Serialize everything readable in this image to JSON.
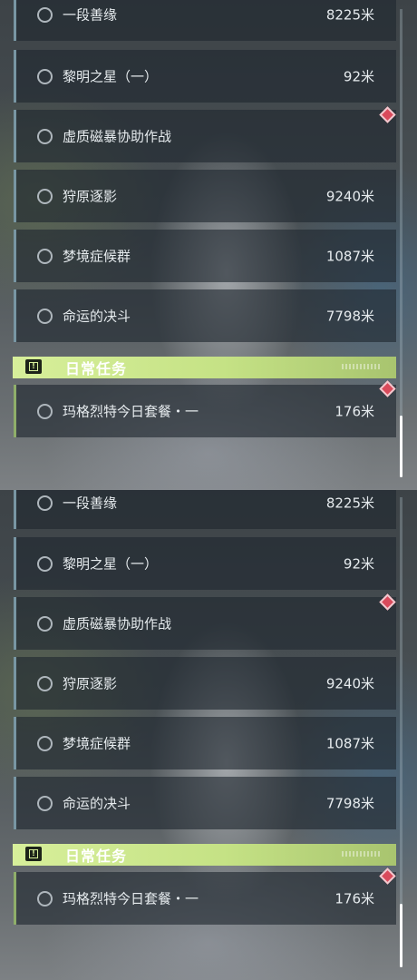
{
  "panels": [
    {
      "quests": [
        {
          "name": "一段善缘",
          "distance": "8225米"
        },
        {
          "name": "黎明之星（一）",
          "distance": "92米"
        },
        {
          "name": "虚质磁暴协助作战",
          "distance": ""
        },
        {
          "name": "狩原逐影",
          "distance": "9240米"
        },
        {
          "name": "梦境症候群",
          "distance": "1087米"
        },
        {
          "name": "命运的决斗",
          "distance": "7798米"
        }
      ],
      "daily_header": {
        "title": "日常任务",
        "icon": "alert-box-icon"
      },
      "daily_quests": [
        {
          "name": "玛格烈特今日套餐・一",
          "distance": "176米"
        }
      ]
    },
    {
      "quests": [
        {
          "name": "一段善缘",
          "distance": "8225米"
        },
        {
          "name": "黎明之星（一）",
          "distance": "92米"
        },
        {
          "name": "虚质磁暴协助作战",
          "distance": ""
        },
        {
          "name": "狩原逐影",
          "distance": "9240米"
        },
        {
          "name": "梦境症候群",
          "distance": "1087米"
        },
        {
          "name": "命运的决斗",
          "distance": "7798米"
        }
      ],
      "daily_header": {
        "title": "日常任务",
        "icon": "alert-box-icon"
      },
      "daily_quests": [
        {
          "name": "玛格烈特今日套餐・一",
          "distance": "176米"
        }
      ]
    }
  ],
  "icons": {
    "quest_status": "circle-outline-icon",
    "tracking_marker": "red-diamond-marker-icon"
  },
  "colors": {
    "daily_accent": "#c5e285",
    "marker_red": "#d94a5b",
    "main_quest_border": "#7896a3",
    "daily_quest_border": "#8fae6a"
  }
}
